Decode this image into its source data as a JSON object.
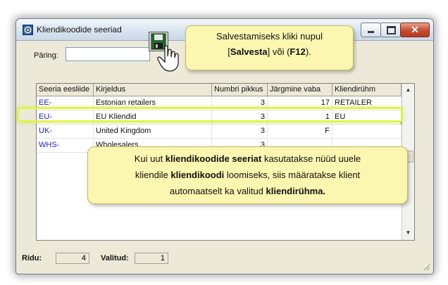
{
  "window": {
    "title": "Kliendikoodide seeriad"
  },
  "query": {
    "label": "Päring:",
    "value": ""
  },
  "table": {
    "headers": [
      "Seeria eesliide",
      "Kirjeldus",
      "Numbri pikkus",
      "Järgmine vaba",
      "Kliendirühm"
    ],
    "rows": [
      {
        "prefix": "EE-",
        "description": "Estonian retailers",
        "length": "3",
        "next_free": "17",
        "group": "RETAILER"
      },
      {
        "prefix": "EU-",
        "description": "EU Kliendid",
        "length": "3",
        "next_free": "1",
        "group": "EU"
      },
      {
        "prefix": "UK-",
        "description": "United Kingdom",
        "length": "3",
        "next_free": "F",
        "group": ""
      },
      {
        "prefix": "WHS-",
        "description": "Wholesalers",
        "length": "3",
        "next_free": "",
        "group": ""
      }
    ]
  },
  "status": {
    "rows_label": "Ridu:",
    "rows_value": "4",
    "selected_label": "Valitud:",
    "selected_value": "1"
  },
  "callout_save": {
    "line1": "Salvestamiseks kliki nupul",
    "bracket_open": "[",
    "save_word": "Salvesta",
    "mid": "] või (",
    "key": "F12",
    "close": ")."
  },
  "callout_info": {
    "l1a": "Kui uut ",
    "l1b": "kliendikoodide seeriat",
    "l1c": " kasutatakse nüüd uuele",
    "l2a": "kliendile ",
    "l2b": "kliendikoodi",
    "l2c": " loomiseks, siis määratakse klient",
    "l3a": "automaatselt ka valitud ",
    "l3b": "kliendirühma."
  },
  "icons": {
    "app": "series-icon",
    "save": "save-icon",
    "pointer": "hand-pointer-icon"
  },
  "colors": {
    "highlight": "#e2f24e",
    "callout_bg": "#fbf6b0",
    "code_text": "#1a25c4"
  }
}
